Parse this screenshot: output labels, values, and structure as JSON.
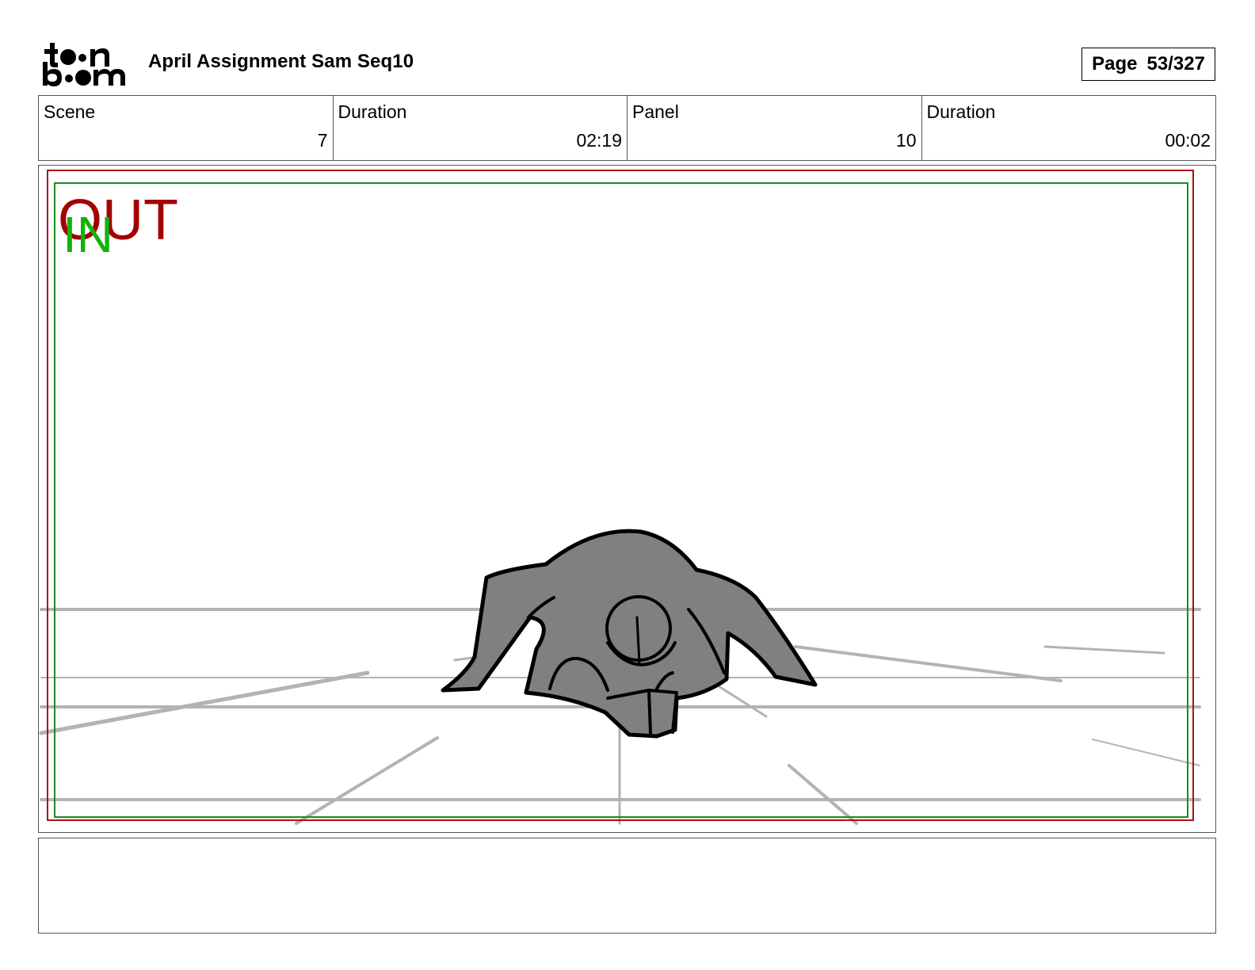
{
  "header": {
    "logo_text": "toon boom",
    "project_title": "April Assignment Sam Seq10",
    "page_label": "Page",
    "page_number": "53/327"
  },
  "info_table": {
    "scene_label": "Scene",
    "scene_value": "7",
    "scene_duration_label": "Duration",
    "scene_duration_value": "02:19",
    "panel_label": "Panel",
    "panel_value": "10",
    "panel_duration_label": "Duration",
    "panel_duration_value": "00:02"
  },
  "panel_frame": {
    "out_label": "OUT",
    "in_label": "IN",
    "out_color": "#a30000",
    "in_color": "#11b30b",
    "out_frame_color": "#b01010",
    "in_frame_color": "#1f8a1f"
  },
  "notes": {
    "text": ""
  }
}
